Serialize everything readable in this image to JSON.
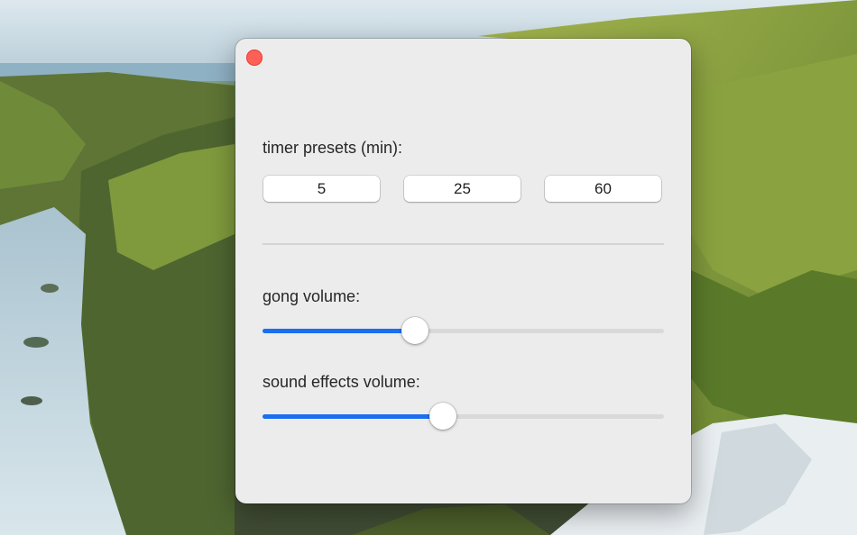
{
  "window": {
    "controls": {
      "close_color": "#fe5f57"
    }
  },
  "presets": {
    "label": "timer presets (min):",
    "buttons": [
      "5",
      "25",
      "60"
    ]
  },
  "gong": {
    "label": "gong volume:",
    "value": 0.38
  },
  "sound_effects": {
    "label": "sound effects volume:",
    "value": 0.45
  },
  "colors": {
    "accent": "#1a6ef0",
    "window_bg": "#ececec"
  }
}
